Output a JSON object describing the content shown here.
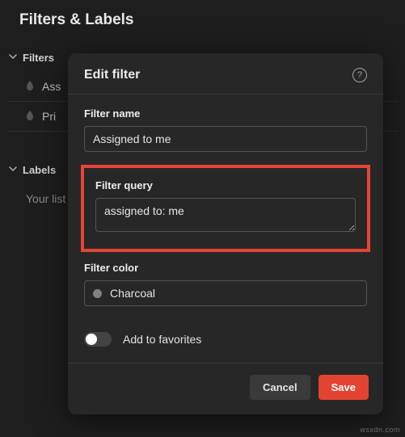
{
  "page": {
    "title": "Filters & Labels"
  },
  "sections": {
    "filters": {
      "title": "Filters",
      "items": [
        "Ass",
        "Pri"
      ]
    },
    "labels": {
      "title": "Labels",
      "emptyText": "Your list"
    }
  },
  "modal": {
    "title": "Edit filter",
    "helpGlyph": "?",
    "filterName": {
      "label": "Filter name",
      "value": "Assigned to me"
    },
    "filterQuery": {
      "label": "Filter query",
      "value": "assigned to: me"
    },
    "filterColor": {
      "label": "Filter color",
      "value": "Charcoal",
      "swatchHex": "#808080"
    },
    "addToFavorites": {
      "label": "Add to favorites",
      "on": false
    },
    "buttons": {
      "cancel": "Cancel",
      "save": "Save"
    }
  },
  "watermark": "wsxdn.com"
}
